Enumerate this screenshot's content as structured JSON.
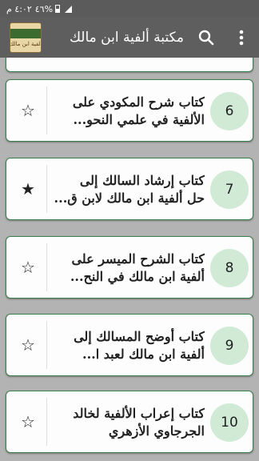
{
  "status_bar": {
    "time": "٤:٠٢ م",
    "battery": "٤٦%"
  },
  "app_bar": {
    "title": "مكتبة ألفية ابن مالك",
    "logo_text": "ألفية ابن مالك"
  },
  "books": [
    {
      "number": "6",
      "line1": "كتاب شرح المكودي على",
      "line2": "الألفية في علمي النحو...",
      "favorite": false
    },
    {
      "number": "7",
      "line1": "كتاب إرشاد السالك إلى",
      "line2": "حل ألفية ابن مالك لابن ق...",
      "favorite": true
    },
    {
      "number": "8",
      "line1": "كتاب الشرح الميسر على",
      "line2": "ألفية ابن مالك في النح...",
      "favorite": false
    },
    {
      "number": "9",
      "line1": "كتاب أوضح المسالك إلى",
      "line2": "ألفية ابن مالك لعبد ا...",
      "favorite": false
    },
    {
      "number": "10",
      "line1": "كتاب إعراب الألفية لخالد",
      "line2": "الجرجاوي الأزهري",
      "favorite": false
    }
  ],
  "icons": {
    "star_empty": "☆",
    "star_filled": "★"
  }
}
